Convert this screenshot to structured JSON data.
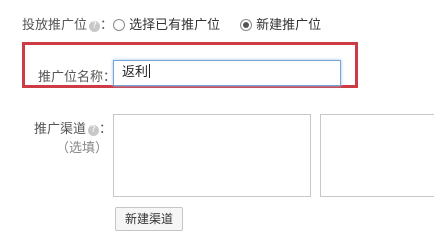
{
  "placement": {
    "label": "投放推广位",
    "help_glyph": "?",
    "colon": "：",
    "options": [
      {
        "label": "选择已有推广位",
        "checked": false
      },
      {
        "label": "新建推广位",
        "checked": true
      }
    ]
  },
  "name_field": {
    "label": "推广位名称：",
    "value": "返利"
  },
  "channel": {
    "label": "推广渠道",
    "help_glyph": "?",
    "colon": "：",
    "optional": "（选填）",
    "new_button": "新建渠道"
  },
  "colors": {
    "highlight": "#cd3b45",
    "input_focus": "#76a6d8"
  }
}
